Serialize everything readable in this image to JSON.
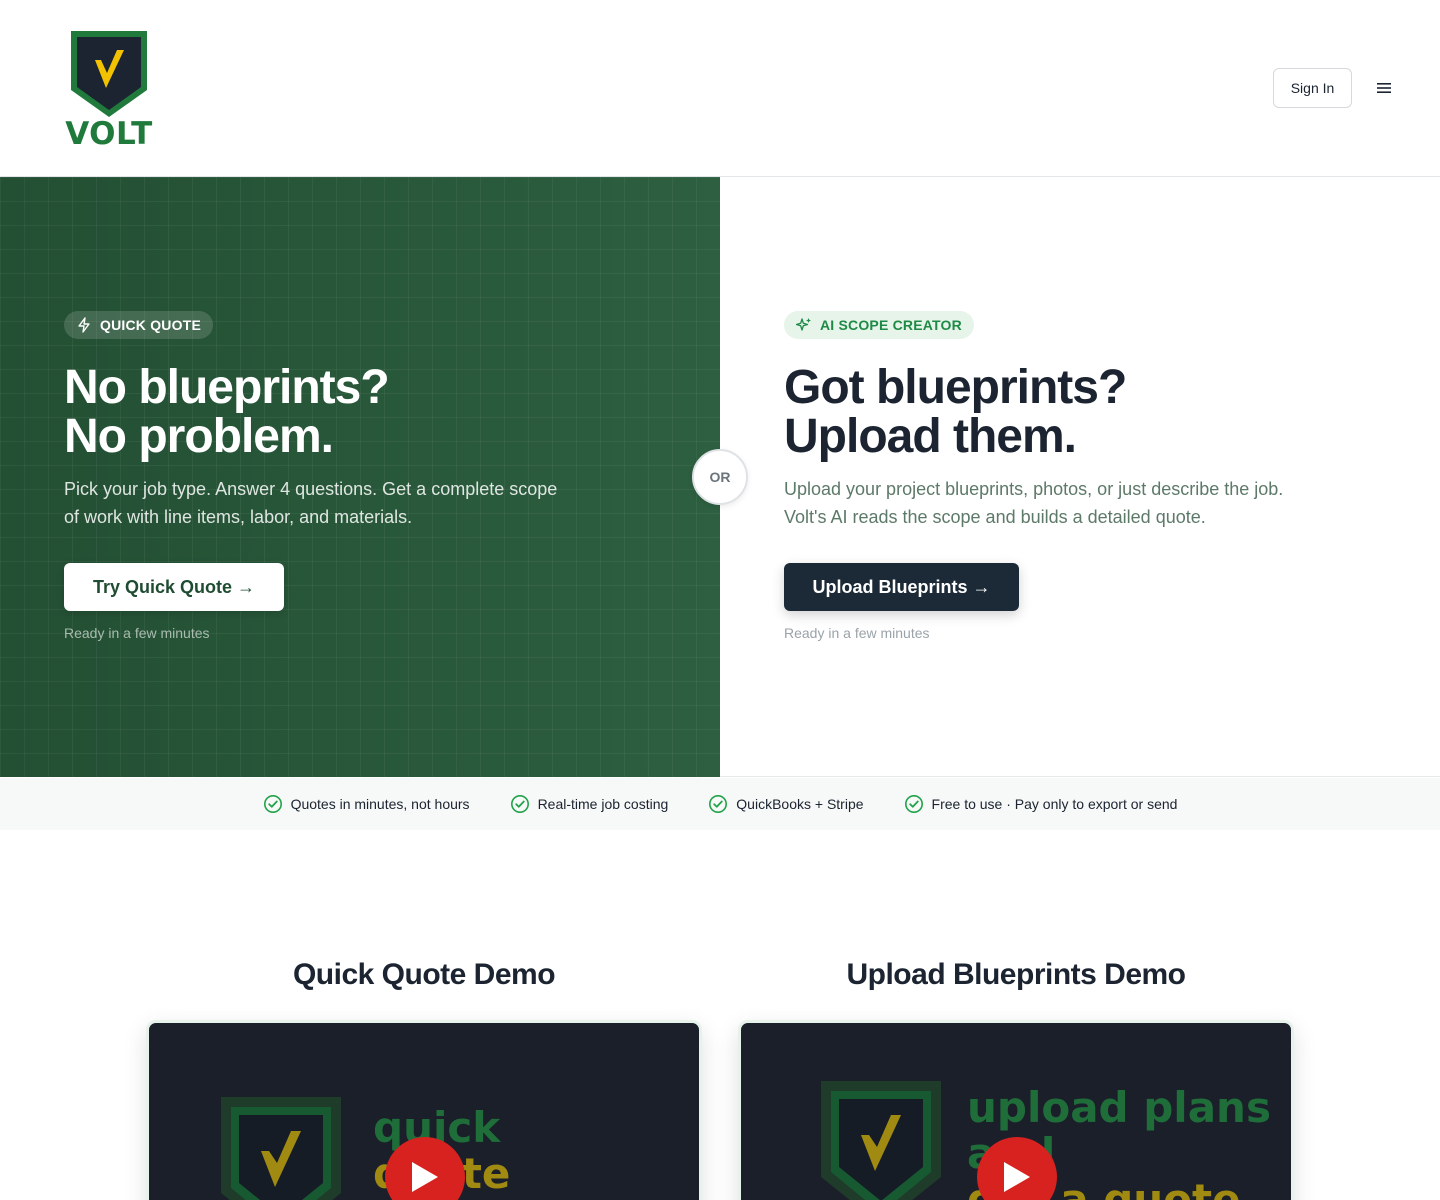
{
  "header": {
    "logo_text": "VOLT",
    "signin_label": "Sign In",
    "menu_icon": "hamburger-menu-icon"
  },
  "hero_left": {
    "pill_label": "QUICK QUOTE",
    "pill_icon": "lightning-icon",
    "title_line1": "No blueprints?",
    "title_line2": "No problem.",
    "subtitle_line1": "Pick your job type. Answer 4 questions. Get a complete scope",
    "subtitle_line2": "of work with line items, labor, and materials.",
    "cta_label": "Try Quick Quote →",
    "note": "Ready in a few minutes"
  },
  "or_label": "OR",
  "hero_right": {
    "pill_label": "AI SCOPE CREATOR",
    "pill_icon": "sparkles-icon",
    "title_line1": "Got blueprints?",
    "title_line2": "Upload them.",
    "subtitle_line1": "Upload your project blueprints, photos, or just describe the job.",
    "subtitle_line2": "Volt's AI reads the scope and builds a detailed quote.",
    "cta_label": "Upload Blueprints →",
    "note": "Ready in a few minutes"
  },
  "features": [
    {
      "label": "Quotes in minutes, not hours"
    },
    {
      "label": "Real-time job costing"
    },
    {
      "label": "QuickBooks + Stripe"
    },
    {
      "label": "Free to use · Pay only to export or send"
    }
  ],
  "demos": [
    {
      "title": "Quick Quote Demo",
      "video_text_line1": "quick",
      "video_text_line2": "quote"
    },
    {
      "title": "Upload Blueprints Demo",
      "video_text_line1": "upload plans",
      "video_text_line2": "and",
      "video_text_line3": "get a quote"
    }
  ],
  "colors": {
    "brand_green": "#1f7a3c",
    "hero_green": "#2d5f40",
    "dark_navy": "#1b2a36",
    "accent_yellow": "#f2c200",
    "play_red": "#d8221f"
  }
}
